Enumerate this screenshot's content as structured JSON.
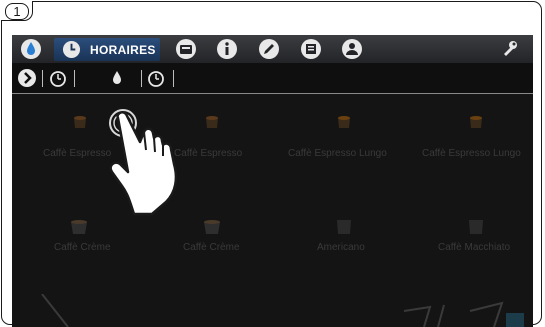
{
  "step": {
    "number": "1"
  },
  "topbar": {
    "active_tab_label": "HORAIRES",
    "icons": [
      "water-drop-icon",
      "clock-icon",
      "card-icon",
      "info-icon",
      "pencil-icon",
      "statistics-icon",
      "user-icon",
      "wrench-icon"
    ]
  },
  "subtabs": {
    "icons": [
      "chevron-right-icon",
      "timer-icon",
      "drop-icon",
      "timer-icon"
    ]
  },
  "products": [
    {
      "label": "Caffè Espresso"
    },
    {
      "label": "Caffè Espresso"
    },
    {
      "label": "Caffè Espresso Lungo"
    },
    {
      "label": "Caffè Espresso Lungo"
    },
    {
      "label": "Caffè Crème"
    },
    {
      "label": "Caffè Crème"
    },
    {
      "label": "Americano"
    },
    {
      "label": "Caffè Macchiato"
    }
  ],
  "colors": {
    "topbar_active": "#2b4e7c",
    "screen_bg": "#141414",
    "product_text": "#3a3a3a"
  }
}
